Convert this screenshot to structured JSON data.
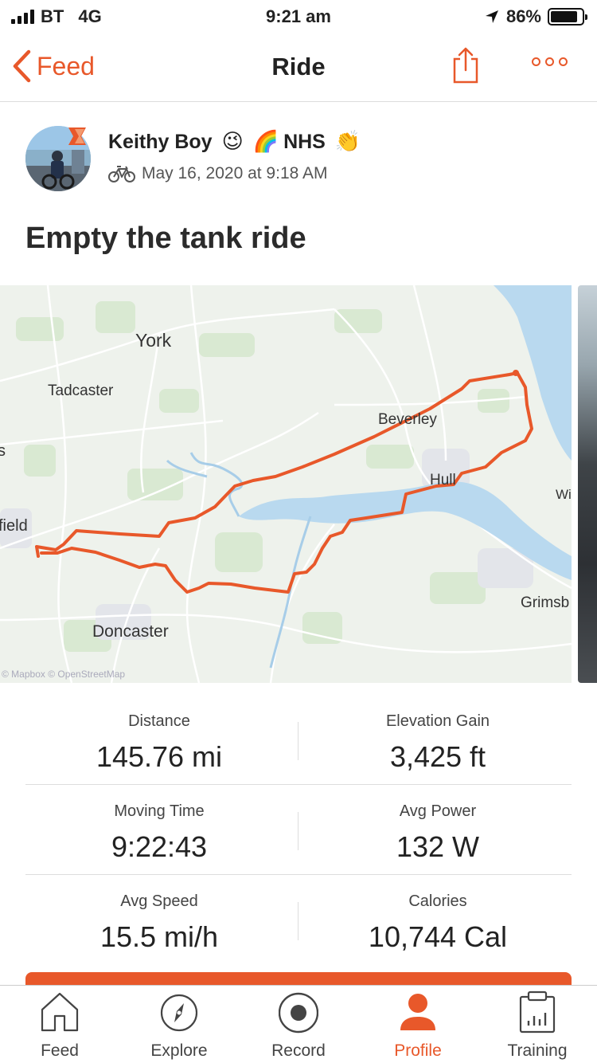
{
  "status_bar": {
    "carrier": "BT",
    "network": "4G",
    "time": "9:21 am",
    "battery": "86%",
    "battery_level": 0.86,
    "location_icon": "location-arrow-icon"
  },
  "nav": {
    "back_label": "Feed",
    "title": "Ride",
    "share_icon": "share-icon",
    "more_icon": "more-icon"
  },
  "athlete": {
    "name": "Keithy Boy",
    "name_suffix": "NHS",
    "emojis": [
      "😉",
      "🌈",
      "👏"
    ],
    "date": "May 16, 2020 at 9:18 AM",
    "activity_icon": "bike-icon"
  },
  "activity": {
    "title": "Empty the tank ride"
  },
  "map": {
    "labels": {
      "york": "York",
      "tadcaster": "Tadcaster",
      "beverley": "Beverley",
      "hull": "Hull",
      "wi": "Wi",
      "field": "field",
      "s": "s",
      "doncaster": "Doncaster",
      "grimsby": "Grimsb"
    },
    "attribution": "© Mapbox © OpenStreetMap",
    "route_color": "#e8582a",
    "water_color": "#b9d9ef"
  },
  "stats": [
    {
      "label": "Distance",
      "value": "145.76 mi"
    },
    {
      "label": "Elevation Gain",
      "value": "3,425 ft"
    },
    {
      "label": "Moving Time",
      "value": "9:22:43"
    },
    {
      "label": "Avg Power",
      "value": "132 W"
    },
    {
      "label": "Avg Speed",
      "value": "15.5 mi/h"
    },
    {
      "label": "Calories",
      "value": "10,744 Cal"
    }
  ],
  "tabs": [
    {
      "label": "Feed",
      "icon": "home-icon"
    },
    {
      "label": "Explore",
      "icon": "compass-icon"
    },
    {
      "label": "Record",
      "icon": "record-icon"
    },
    {
      "label": "Profile",
      "icon": "profile-icon",
      "active": true
    },
    {
      "label": "Training",
      "icon": "training-icon"
    }
  ],
  "colors": {
    "accent": "#e8582a"
  }
}
